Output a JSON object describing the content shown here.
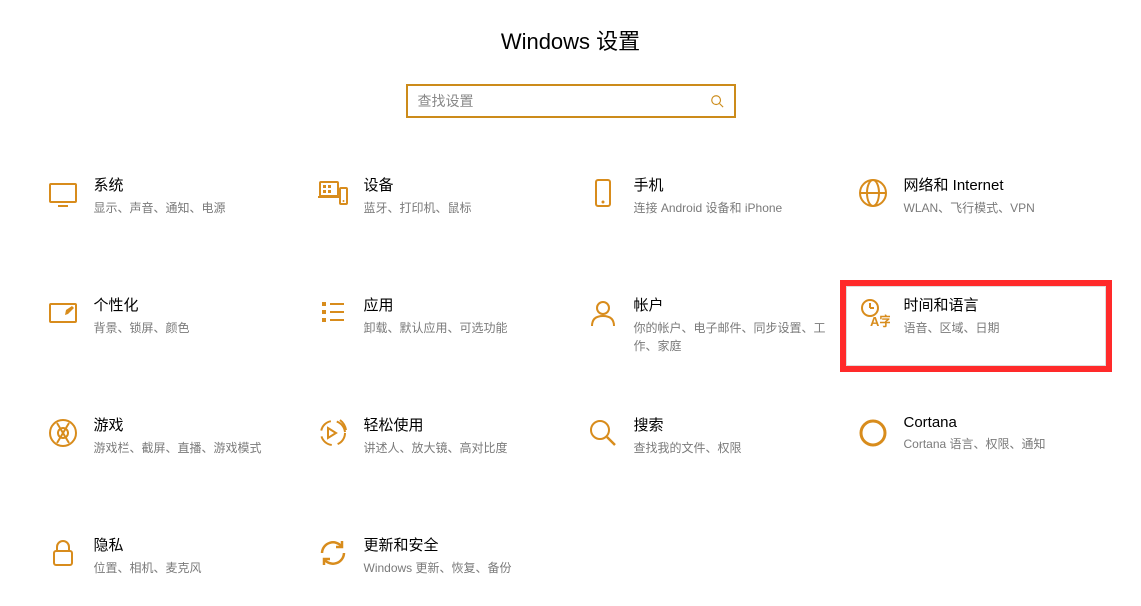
{
  "header": {
    "title": "Windows 设置"
  },
  "search": {
    "placeholder": "查找设置"
  },
  "tiles": [
    {
      "icon": "system",
      "title": "系统",
      "desc": "显示、声音、通知、电源"
    },
    {
      "icon": "devices",
      "title": "设备",
      "desc": "蓝牙、打印机、鼠标"
    },
    {
      "icon": "phone",
      "title": "手机",
      "desc": "连接 Android 设备和 iPhone"
    },
    {
      "icon": "network",
      "title": "网络和 Internet",
      "desc": "WLAN、飞行模式、VPN"
    },
    {
      "icon": "personalization",
      "title": "个性化",
      "desc": "背景、锁屏、颜色"
    },
    {
      "icon": "apps",
      "title": "应用",
      "desc": "卸载、默认应用、可选功能"
    },
    {
      "icon": "accounts",
      "title": "帐户",
      "desc": "你的帐户、电子邮件、同步设置、工作、家庭"
    },
    {
      "icon": "time",
      "title": "时间和语言",
      "desc": "语音、区域、日期",
      "highlighted": true
    },
    {
      "icon": "gaming",
      "title": "游戏",
      "desc": "游戏栏、截屏、直播、游戏模式"
    },
    {
      "icon": "ease",
      "title": "轻松使用",
      "desc": "讲述人、放大镜、高对比度"
    },
    {
      "icon": "search",
      "title": "搜索",
      "desc": "查找我的文件、权限"
    },
    {
      "icon": "cortana",
      "title": "Cortana",
      "desc": "Cortana 语言、权限、通知"
    },
    {
      "icon": "privacy",
      "title": "隐私",
      "desc": "位置、相机、麦克风"
    },
    {
      "icon": "update",
      "title": "更新和安全",
      "desc": "Windows 更新、恢复、备份"
    }
  ]
}
